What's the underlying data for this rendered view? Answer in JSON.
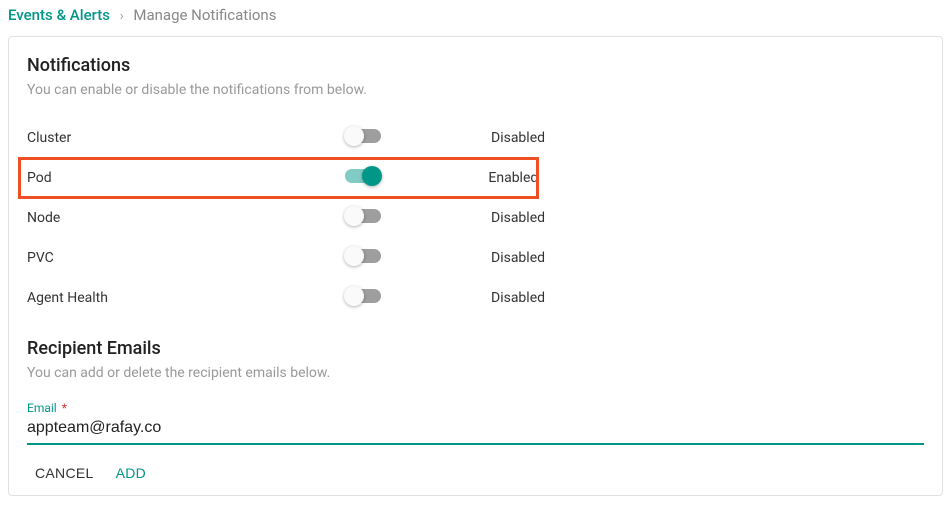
{
  "breadcrumb": {
    "root": "Events & Alerts",
    "separator": "›",
    "current": "Manage Notifications"
  },
  "notifications": {
    "title": "Notifications",
    "subtitle": "You can enable or disable the notifications from below.",
    "rows": [
      {
        "label": "Cluster",
        "enabled": false,
        "state": "Disabled",
        "highlight": false
      },
      {
        "label": "Pod",
        "enabled": true,
        "state": "Enabled",
        "highlight": true
      },
      {
        "label": "Node",
        "enabled": false,
        "state": "Disabled",
        "highlight": false
      },
      {
        "label": "PVC",
        "enabled": false,
        "state": "Disabled",
        "highlight": false
      },
      {
        "label": "Agent Health",
        "enabled": false,
        "state": "Disabled",
        "highlight": false
      }
    ]
  },
  "recipients": {
    "title": "Recipient Emails",
    "subtitle": "You can add or delete the recipient emails below.",
    "email_label": "Email",
    "email_required_mark": "*",
    "email_value": "appteam@rafay.co"
  },
  "buttons": {
    "cancel": "CANCEL",
    "add": "ADD"
  }
}
